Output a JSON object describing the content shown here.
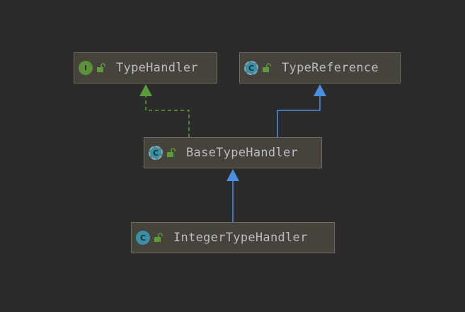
{
  "diagram": {
    "nodes": {
      "type_handler": {
        "name": "TypeHandler",
        "kind": "interface",
        "badge": "I",
        "visibility": "public"
      },
      "type_reference": {
        "name": "TypeReference",
        "kind": "abstract-class",
        "badge": "C",
        "visibility": "public"
      },
      "base_type_handler": {
        "name": "BaseTypeHandler",
        "kind": "abstract-class",
        "badge": "C",
        "visibility": "public"
      },
      "integer_type_handler": {
        "name": "IntegerTypeHandler",
        "kind": "class",
        "badge": "C",
        "visibility": "public"
      }
    },
    "edges": [
      {
        "from": "BaseTypeHandler",
        "to": "TypeHandler",
        "relation": "implements",
        "style": "dashed",
        "color": "#5a9a3c"
      },
      {
        "from": "BaseTypeHandler",
        "to": "TypeReference",
        "relation": "extends",
        "style": "solid",
        "color": "#4a90e2"
      },
      {
        "from": "IntegerTypeHandler",
        "to": "BaseTypeHandler",
        "relation": "extends",
        "style": "solid",
        "color": "#4a90e2"
      }
    ]
  },
  "colors": {
    "background": "#2b2b2b",
    "node_fill": "#45433c",
    "node_border": "#6f6c63",
    "text": "#b9bcc1",
    "interface_badge": "#5e8f3a",
    "class_badge": "#3c8fa3",
    "lock": "#5e9a3a",
    "implements_edge": "#5a9a3c",
    "extends_edge": "#4a90e2"
  }
}
